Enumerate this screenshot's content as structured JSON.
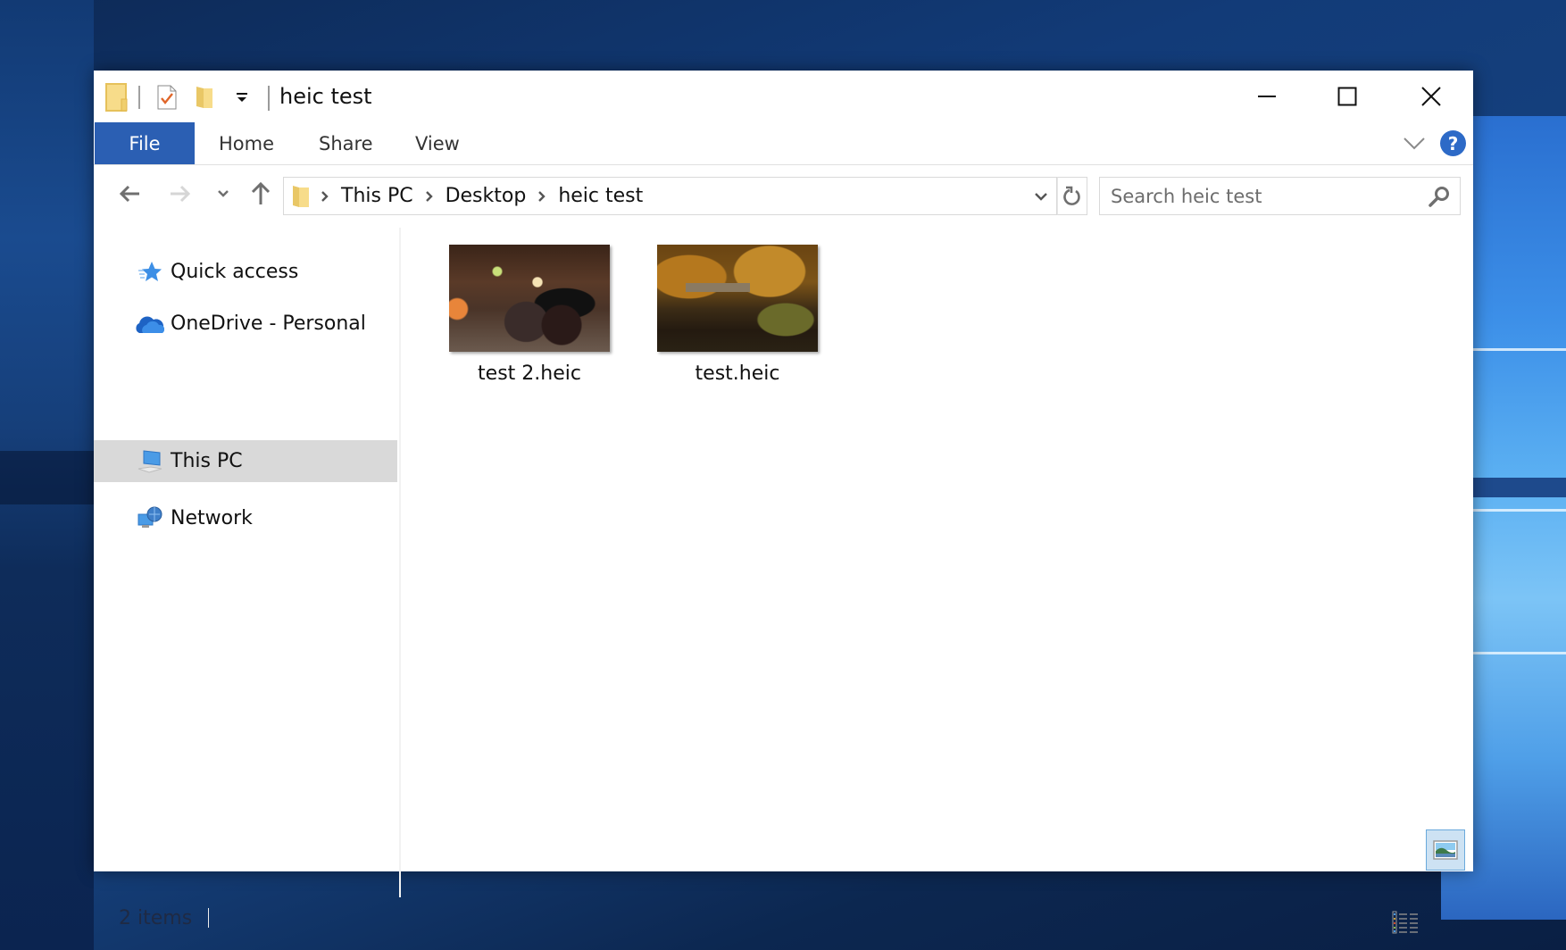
{
  "window": {
    "title": "heic test",
    "controls": {
      "minimize": "Minimize",
      "maximize": "Maximize",
      "close": "Close"
    }
  },
  "quick_access_toolbar": {
    "icons": [
      "folder-icon",
      "properties-icon",
      "new-folder-icon",
      "customize-dropdown-icon"
    ]
  },
  "ribbon": {
    "file_tab": "File",
    "tabs": [
      {
        "label": "Home"
      },
      {
        "label": "Share"
      },
      {
        "label": "View"
      }
    ],
    "help_label": "?",
    "accent_color": "#2b5fb3"
  },
  "navigation": {
    "back": "back-arrow-icon",
    "forward": "forward-arrow-icon",
    "recent": "recent-locations-icon",
    "up": "up-arrow-icon",
    "breadcrumb": [
      {
        "label": "This PC"
      },
      {
        "label": "Desktop"
      },
      {
        "label": "heic test"
      }
    ],
    "search": {
      "value": "",
      "placeholder": "Search heic test"
    }
  },
  "sidebar": {
    "items": [
      {
        "label": "Quick access",
        "icon": "star-icon",
        "selected": false
      },
      {
        "label": "OneDrive - Personal",
        "icon": "cloud-icon",
        "selected": false
      },
      {
        "label": "This PC",
        "icon": "computer-icon",
        "selected": true
      },
      {
        "label": "Network",
        "icon": "network-icon",
        "selected": false
      }
    ]
  },
  "files": [
    {
      "name": "test 2.heic",
      "thumbnail": "night-city-street"
    },
    {
      "name": "test.heic",
      "thumbnail": "autumn-lake-gazebo"
    }
  ],
  "status_bar": {
    "item_count": "2 items",
    "views": [
      "details-view",
      "large-icons-view"
    ],
    "active_view": "large-icons-view"
  }
}
